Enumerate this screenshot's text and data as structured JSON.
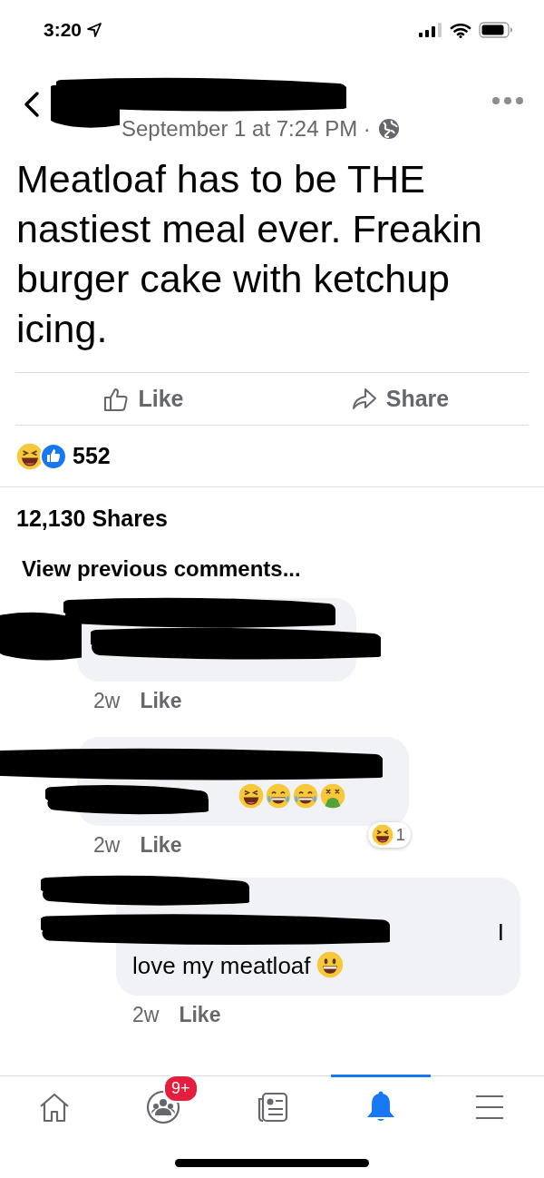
{
  "status_bar": {
    "time": "3:20"
  },
  "post": {
    "timestamp": "September 1 at 7:24 PM ·",
    "text": "Meatloaf has to be THE nastiest meal ever. Freakin burger cake with ketchup icing."
  },
  "actions": [
    {
      "kind": "like",
      "label": "Like"
    },
    {
      "kind": "share",
      "label": "Share"
    }
  ],
  "reactions": {
    "count": "552"
  },
  "shares": "12,130 Shares",
  "view_previous": "View previous comments...",
  "comments": [
    {
      "kind": "names-only",
      "time": "2w",
      "like": "Like"
    },
    {
      "kind": "emoji-reply",
      "time": "2w",
      "like": "Like",
      "reaction_count": "1",
      "children": [
        {
          "kind": "text-reply",
          "text_lines": [
            "I",
            "love my meatloaf"
          ],
          "time": "2w",
          "like": "Like"
        }
      ]
    }
  ],
  "nav": [
    {
      "kind": "home",
      "selected": false
    },
    {
      "kind": "groups",
      "selected": false,
      "badge": "9+"
    },
    {
      "kind": "news",
      "selected": false
    },
    {
      "kind": "bell",
      "selected": true
    },
    {
      "kind": "menu",
      "selected": false
    }
  ]
}
